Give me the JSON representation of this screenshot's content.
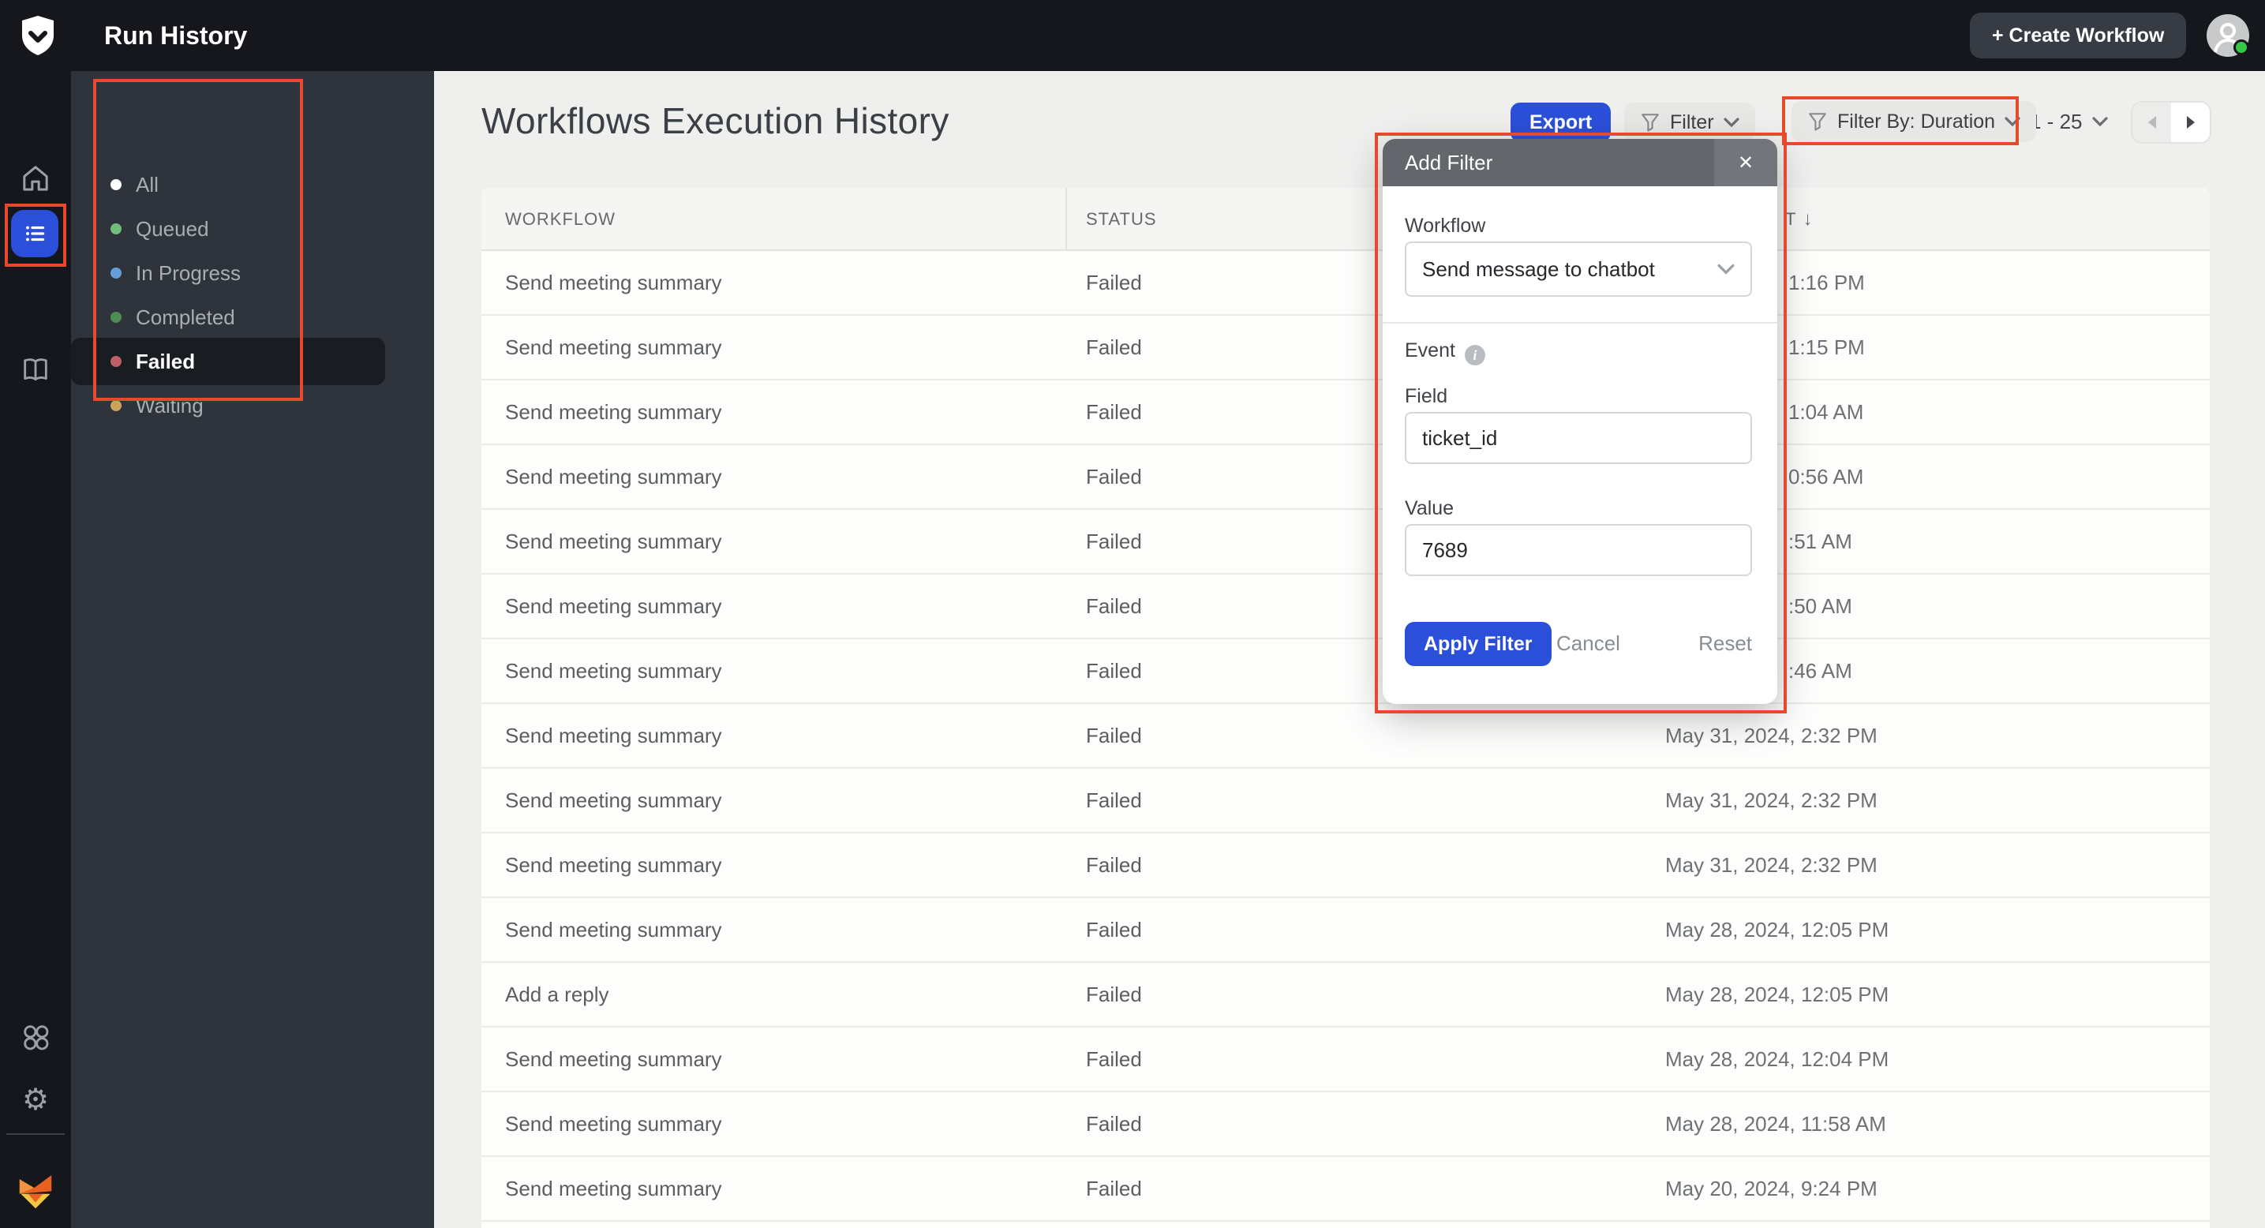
{
  "topbar": {
    "title": "Run History",
    "create_workflow_label": "+ Create Workflow"
  },
  "sidebar": {
    "items": [
      {
        "label": "All",
        "dot_color": "#ffffff",
        "selected": false
      },
      {
        "label": "Queued",
        "dot_color": "#72bd7b",
        "selected": false
      },
      {
        "label": "In Progress",
        "dot_color": "#659fd9",
        "selected": false
      },
      {
        "label": "Completed",
        "dot_color": "#4f8b55",
        "selected": false
      },
      {
        "label": "Failed",
        "dot_color": "#bd6066",
        "selected": true
      },
      {
        "label": "Waiting",
        "dot_color": "#c8a359",
        "selected": false
      }
    ]
  },
  "main": {
    "heading": "Workflows Execution History",
    "export_label": "Export",
    "filter_label": "Filter",
    "filter_by_label": "Filter By: Duration",
    "pagination_range": "1 - 25"
  },
  "table": {
    "columns": [
      {
        "label": "WORKFLOW"
      },
      {
        "label": "STATUS"
      },
      {
        "label": "T",
        "sort_arrow": "↓"
      }
    ],
    "rows": [
      {
        "workflow": "Send meeting summary",
        "status": "Failed",
        "time": "1:16 PM",
        "time_partial": true
      },
      {
        "workflow": "Send meeting summary",
        "status": "Failed",
        "time": "1:15 PM",
        "time_partial": true
      },
      {
        "workflow": "Send meeting summary",
        "status": "Failed",
        "time": "1:04 AM",
        "time_partial": true
      },
      {
        "workflow": "Send meeting summary",
        "status": "Failed",
        "time": "0:56 AM",
        "time_partial": true
      },
      {
        "workflow": "Send meeting summary",
        "status": "Failed",
        "time": ":51 AM",
        "time_partial": true
      },
      {
        "workflow": "Send meeting summary",
        "status": "Failed",
        "time": ":50 AM",
        "time_partial": true
      },
      {
        "workflow": "Send meeting summary",
        "status": "Failed",
        "time": ":46 AM",
        "time_partial": true
      },
      {
        "workflow": "Send meeting summary",
        "status": "Failed",
        "time": "May 31, 2024, 2:32 PM",
        "time_partial": false
      },
      {
        "workflow": "Send meeting summary",
        "status": "Failed",
        "time": "May 31, 2024, 2:32 PM",
        "time_partial": false
      },
      {
        "workflow": "Send meeting summary",
        "status": "Failed",
        "time": "May 31, 2024, 2:32 PM",
        "time_partial": false
      },
      {
        "workflow": "Send meeting summary",
        "status": "Failed",
        "time": "May 28, 2024, 12:05 PM",
        "time_partial": false
      },
      {
        "workflow": "Add a reply",
        "status": "Failed",
        "time": "May 28, 2024, 12:05 PM",
        "time_partial": false
      },
      {
        "workflow": "Send meeting summary",
        "status": "Failed",
        "time": "May 28, 2024, 12:04 PM",
        "time_partial": false
      },
      {
        "workflow": "Send meeting summary",
        "status": "Failed",
        "time": "May 28, 2024, 11:58 AM",
        "time_partial": false
      },
      {
        "workflow": "Send meeting summary",
        "status": "Failed",
        "time": "May 20, 2024, 9:24 PM",
        "time_partial": false
      }
    ]
  },
  "dialog": {
    "title": "Add Filter",
    "close_label": "✕",
    "workflow_label": "Workflow",
    "workflow_value": "Send message to chatbot",
    "event_label": "Event",
    "info_label": "i",
    "field_label": "Field",
    "field_value": "ticket_id",
    "value_label": "Value",
    "value_value": "7689",
    "apply_label": "Apply Filter",
    "cancel_label": "Cancel",
    "reset_label": "Reset"
  },
  "colors": {
    "accent_blue": "#2b4fd8",
    "annotation_red": "#e8492c",
    "topbar_bg": "#15171c",
    "panel_bg": "#2f343c",
    "online_green": "#35c948"
  }
}
